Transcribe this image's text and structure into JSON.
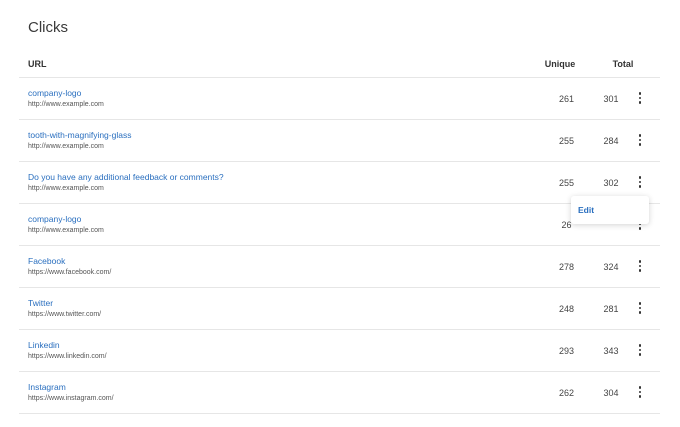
{
  "page": {
    "title": "Clicks"
  },
  "table": {
    "headers": {
      "url": "URL",
      "unique": "Unique",
      "total": "Total"
    },
    "rows": [
      {
        "name": "company-logo",
        "url": "http://www.example.com",
        "unique": "261",
        "total": "301"
      },
      {
        "name": "tooth-with-magnifying-glass",
        "url": "http://www.example.com",
        "unique": "255",
        "total": "284"
      },
      {
        "name": "Do you have any additional feedback or comments?",
        "url": "http://www.example.com",
        "unique": "255",
        "total": "302"
      },
      {
        "name": "company-logo",
        "url": "http://www.example.com",
        "unique": "26",
        "total": ""
      },
      {
        "name": "Facebook",
        "url": "https://www.facebook.com/",
        "unique": "278",
        "total": "324"
      },
      {
        "name": "Twitter",
        "url": "https://www.twitter.com/",
        "unique": "248",
        "total": "281"
      },
      {
        "name": "Linkedin",
        "url": "https://www.linkedin.com/",
        "unique": "293",
        "total": "343"
      },
      {
        "name": "Instagram",
        "url": "https://www.instagram.com/",
        "unique": "262",
        "total": "304"
      }
    ]
  },
  "row_menu": {
    "edit_label": "Edit"
  },
  "colors": {
    "link": "#2a6fbf",
    "divider": "#e6e6e6"
  },
  "icons": {
    "row_menu": "more-vertical-icon"
  }
}
